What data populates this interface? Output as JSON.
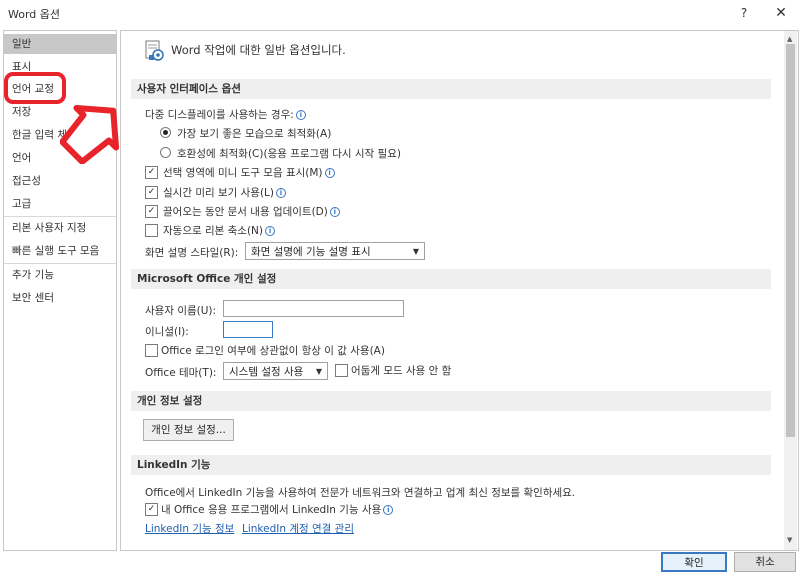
{
  "window": {
    "title": "Word 옵션",
    "help_label": "?",
    "close_label": "✕"
  },
  "sidebar": {
    "items": [
      {
        "label": "일반"
      },
      {
        "label": "표시"
      },
      {
        "label": "언어 교정"
      },
      {
        "label": "저장"
      },
      {
        "label": "한글 입력 체계"
      },
      {
        "label": "언어"
      },
      {
        "label": "접근성"
      },
      {
        "label": "고급"
      },
      {
        "label": "리본 사용자 지정"
      },
      {
        "label": "빠른 실행 도구 모음"
      },
      {
        "label": "추가 기능"
      },
      {
        "label": "보안 센터"
      }
    ],
    "selected": "일반",
    "annotation_color": "#e8232a"
  },
  "main": {
    "intro": "Word 작업에 대한 일반 옵션입니다.",
    "ui_section": {
      "header": "사용자 인터페이스 옵션",
      "multi_display_label": "다중 디스플레이를 사용하는 경우:",
      "radio_best_appearance": "가장 보기 좋은 모습으로 최적화(A)",
      "radio_compat": "호환성에 최적화(C)(응용 프로그램 다시 시작 필요)",
      "mini_toolbar": "선택 영역에 미니 도구 모음 표시(M)",
      "live_preview": "실시간 미리 보기 사용(L)",
      "update_while_drag": "끌어오는 동안 문서 내용 업데이트(D)",
      "auto_collapse": "자동으로 리본 축소(N)",
      "screentip_label": "화면 설명 스타일(R):",
      "screentip_value": "화면 설명에 기능 설명 표시"
    },
    "office_section": {
      "header": "Microsoft Office 개인 설정",
      "username_label": "사용자 이름(U):",
      "username_value": "",
      "initials_label": "이니셜(I):",
      "initials_value": "",
      "always_use": "Office 로그인 여부에 상관없이 항상 이 값 사용(A)",
      "theme_label": "Office 테마(T):",
      "theme_value": "시스템 설정 사용",
      "dark_mode_label": "어둡게 모드 사용 안 함"
    },
    "privacy_section": {
      "header": "개인 정보 설정",
      "button_label": "개인 정보 설정..."
    },
    "linkedin_section": {
      "header": "LinkedIn 기능",
      "description": "Office에서 LinkedIn 기능을 사용하여 전문가 네트워크와 연결하고 업계 최신 정보를 확인하세요.",
      "enable_label": "내 Office 응용 프로그램에서 LinkedIn 기능 사용",
      "link_about": "LinkedIn 기능 정보",
      "link_manage": "LinkedIn 계정 연결 관리"
    }
  },
  "footer": {
    "ok_label": "확인",
    "cancel_label": "취소"
  }
}
